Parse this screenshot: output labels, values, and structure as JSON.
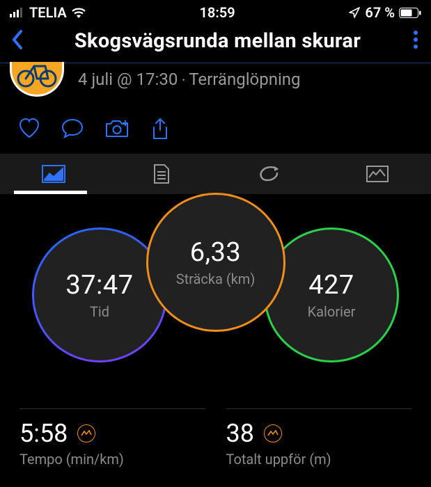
{
  "status_bar": {
    "carrier": "TELIA",
    "time": "18:59",
    "battery": "67 %"
  },
  "header": {
    "title": "Skogsvägsrunda mellan skurar"
  },
  "sub_header": {
    "datetime_activity": "4 juli @ 17:30 ‧ Terränglöpning"
  },
  "metrics": {
    "distance": {
      "value": "6,33",
      "label": "Sträcka (km)"
    },
    "time": {
      "value": "37:47",
      "label": "Tid"
    },
    "calories": {
      "value": "427",
      "label": "Kalorier"
    }
  },
  "bottom": {
    "pace": {
      "value": "5:58",
      "label": "Tempo (min/km)"
    },
    "ascent": {
      "value": "38",
      "label": "Totalt uppför (m)"
    }
  },
  "colors": {
    "accent_blue": "#2e72ff",
    "orange": "#ef8e1b",
    "green": "#2bd14a"
  }
}
